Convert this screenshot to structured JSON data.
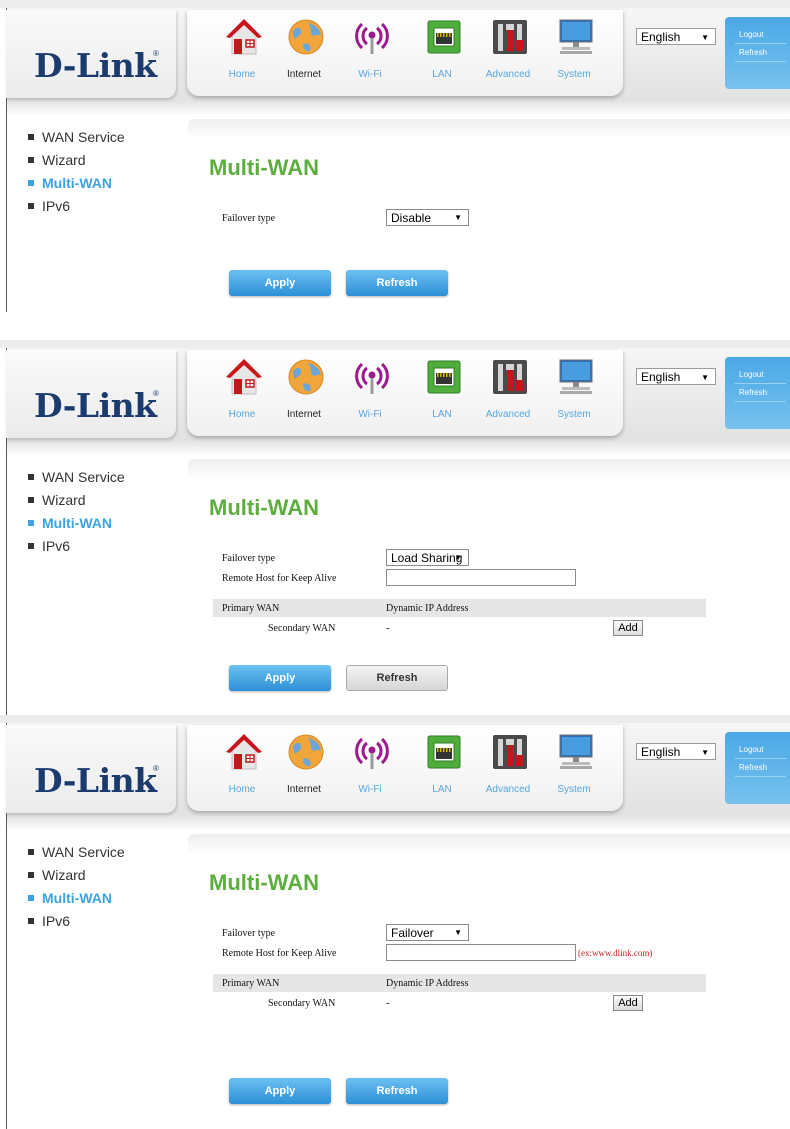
{
  "brand": {
    "logo": "D-Link",
    "registered": "®"
  },
  "nav": [
    {
      "label": "Home",
      "icon": "house-icon"
    },
    {
      "label": "Internet",
      "icon": "globe-icon"
    },
    {
      "label": "Wi-Fi",
      "icon": "wifi-icon"
    },
    {
      "label": "LAN",
      "icon": "lan-port-icon"
    },
    {
      "label": "Advanced",
      "icon": "tools-icon"
    },
    {
      "label": "System",
      "icon": "computer-icon"
    }
  ],
  "language": "English",
  "side_links": [
    "Logout",
    "Refresh"
  ],
  "menu": [
    "WAN Service",
    "Wizard",
    "Multi-WAN",
    "IPv6"
  ],
  "active_menu": "Multi-WAN",
  "page_title": "Multi-WAN",
  "labels": {
    "failover_type": "Failover type",
    "remote_host": "Remote Host for Keep Alive",
    "primary_wan": "Primary WAN",
    "secondary_wan": "Secondary WAN"
  },
  "panels": [
    {
      "failover_value": "Disable",
      "apply": "Apply",
      "refresh": "Refresh",
      "refresh_style": "blue"
    },
    {
      "failover_value": "Load Sharing",
      "remote_host_value": "",
      "primary_wan_value": "Dynamic IP Address",
      "secondary_wan_value": "-",
      "add": "Add",
      "apply": "Apply",
      "refresh": "Refresh",
      "refresh_style": "grey"
    },
    {
      "failover_value": "Failover",
      "remote_host_value": "",
      "remote_host_hint": "(ex:www.dlink.com)",
      "primary_wan_value": "Dynamic IP Address",
      "secondary_wan_value": "-",
      "add": "Add",
      "apply": "Apply",
      "refresh": "Refresh",
      "refresh_style": "blue"
    }
  ],
  "colors": {
    "title_green": "#5cae3f",
    "accent_blue": "#3ca2e0",
    "logo_navy": "#1b3b6e",
    "hint_red": "#d02020"
  }
}
